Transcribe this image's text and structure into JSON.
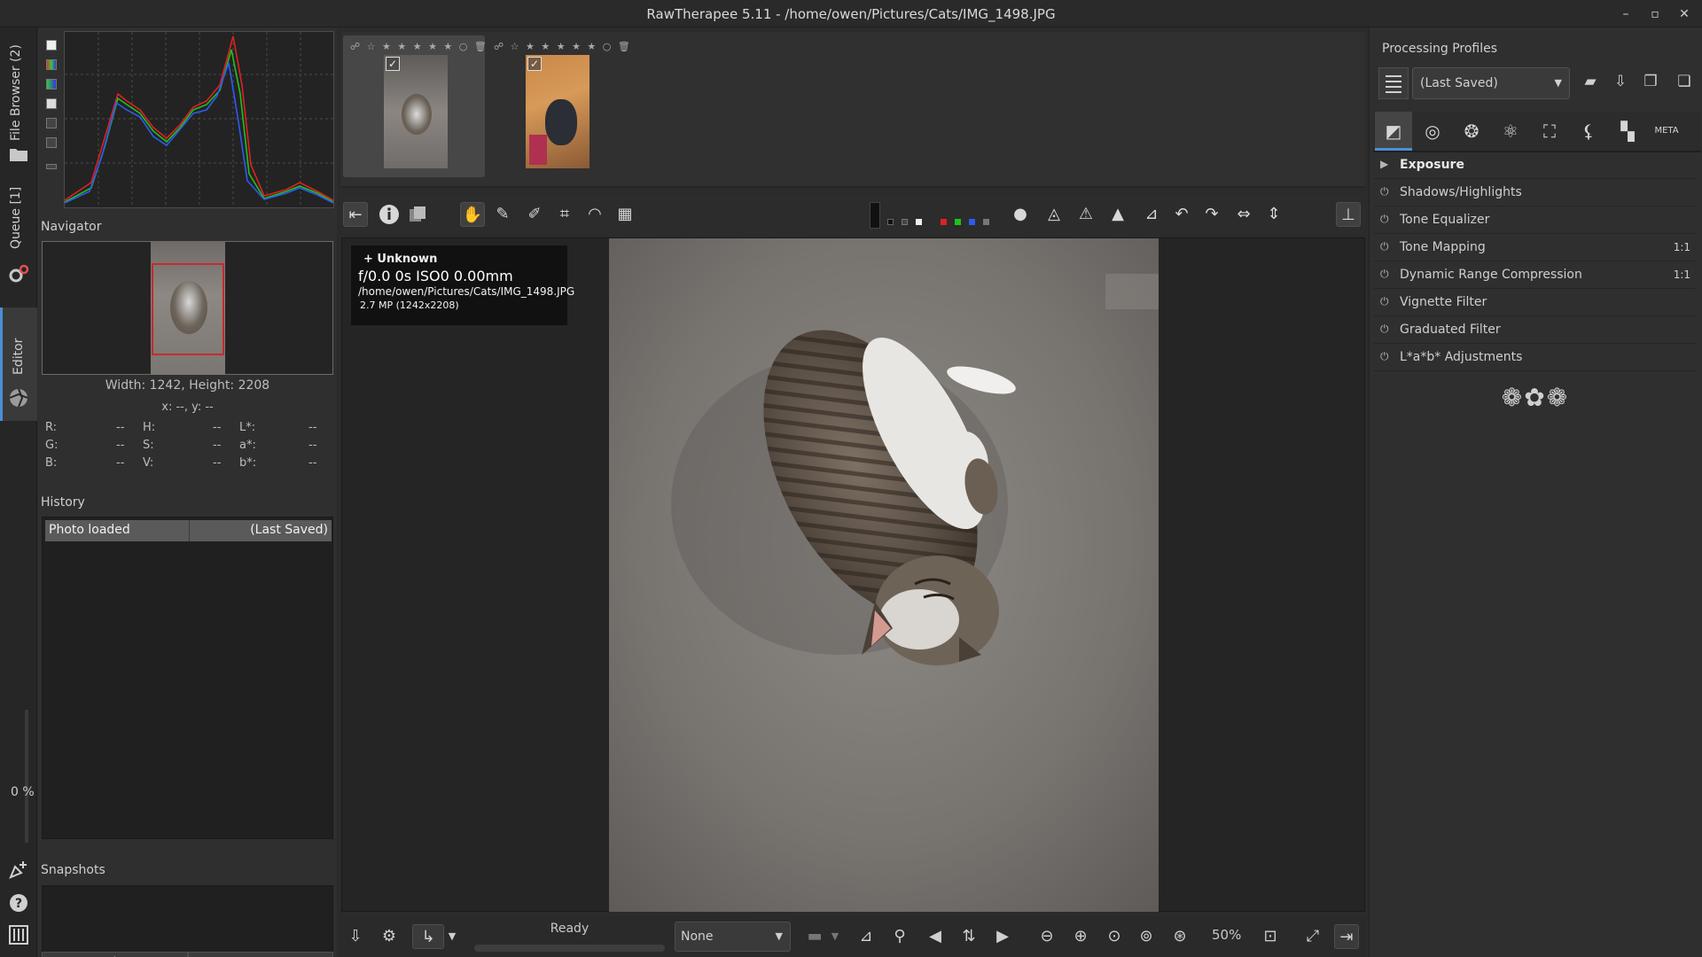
{
  "window": {
    "title": "RawTherapee 5.11 - /home/owen/Pictures/Cats/IMG_1498.JPG",
    "buttons": [
      "–",
      "▫",
      "✕"
    ]
  },
  "vertical_tabs": {
    "file_browser": "File Browser (2)",
    "queue": "Queue [1]",
    "editor": "Editor",
    "progress": "0 %"
  },
  "navigator": {
    "title": "Navigator",
    "dimensions": "Width: 1242, Height: 2208",
    "coords": "x: --, y: --",
    "rows": [
      {
        "l1": "R:",
        "v1": "--",
        "l2": "H:",
        "v2": "--",
        "l3": "L*:",
        "v3": "--"
      },
      {
        "l1": "G:",
        "v1": "--",
        "l2": "S:",
        "v2": "--",
        "l3": "a*:",
        "v3": "--"
      },
      {
        "l1": "B:",
        "v1": "--",
        "l2": "V:",
        "v2": "--",
        "l3": "b*:",
        "v3": "--"
      }
    ]
  },
  "history": {
    "title": "History",
    "row": {
      "action": "Photo loaded",
      "value": "(Last Saved)"
    }
  },
  "snapshots": {
    "title": "Snapshots",
    "add": "+",
    "remove": "−"
  },
  "filmstrip": {
    "thumb_bar": "☍ ☆ ★ ★ ★ ★ ★ ○ 🗑",
    "thumb_bar_2": "☍ ☆ ★ ★ ★ ★ ★ ○ 🗑",
    "check": "✓"
  },
  "image_info": {
    "camera": "+ Unknown",
    "exposure": "f/0.0  0s  ISO0  0.00mm",
    "path": "/home/owen/Pictures/Cats/IMG_1498.JPG",
    "size": "2.7 MP (1242x2208)"
  },
  "status": {
    "ready": "Ready",
    "output_profile": "None",
    "zoom": "50%"
  },
  "processing_profiles": {
    "title": "Processing Profiles",
    "selected": "(Last Saved)"
  },
  "tools": [
    {
      "name": "Exposure",
      "icon": "▶",
      "right": ""
    },
    {
      "name": "Shadows/Highlights",
      "icon": "⏻",
      "right": ""
    },
    {
      "name": "Tone Equalizer",
      "icon": "⏻",
      "right": ""
    },
    {
      "name": "Tone Mapping",
      "icon": "⏻",
      "right": "1:1"
    },
    {
      "name": "Dynamic Range Compression",
      "icon": "⏻",
      "right": "1:1"
    },
    {
      "name": "Vignette Filter",
      "icon": "⏻",
      "right": ""
    },
    {
      "name": "Graduated Filter",
      "icon": "⏻",
      "right": ""
    },
    {
      "name": "L*a*b* Adjustments",
      "icon": "⏻",
      "right": ""
    }
  ],
  "tool_tab_meta": "META",
  "ornament": "❁✿❁",
  "colors": {
    "accent": "#4a8fd8",
    "navigator_selection": "#c62b2b",
    "histogram_red": "#e02020",
    "histogram_green": "#20c020",
    "histogram_blue": "#2a5cf0"
  }
}
